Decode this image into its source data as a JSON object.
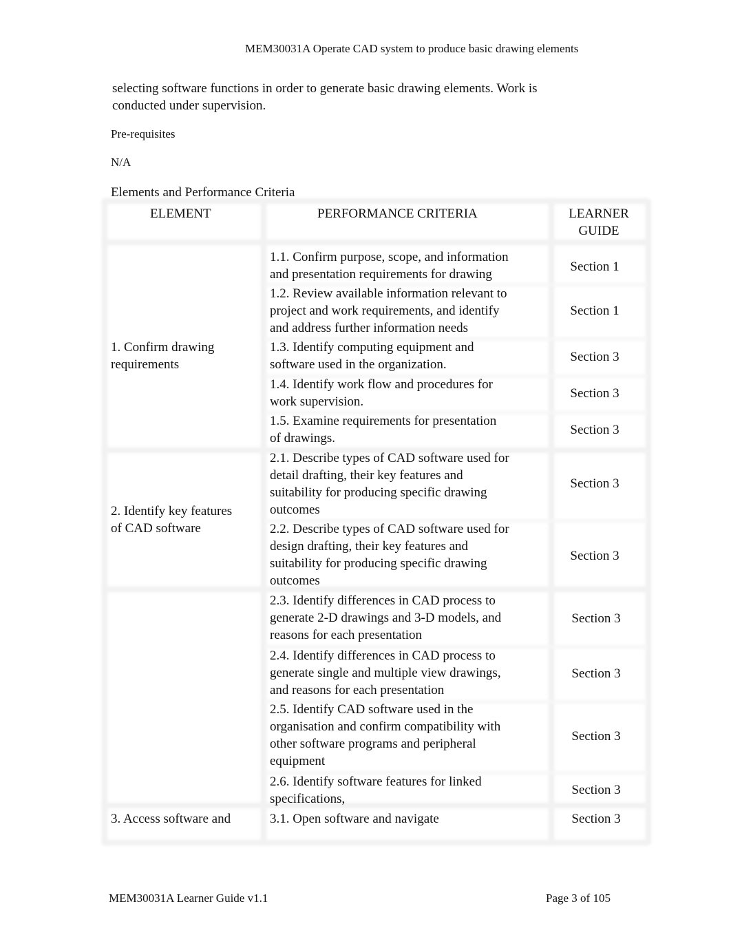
{
  "header": {
    "title": "MEM30031A  Operate CAD system to produce basic drawing elements"
  },
  "intro": "selecting software functions in order to generate basic drawing elements. Work is\nconducted under supervision.",
  "prereq_label": "Pre-requisites",
  "prereq_value": "N/A",
  "table_title": "Elements and Performance Criteria",
  "table": {
    "headers": [
      "ELEMENT",
      "PERFORMANCE CRITERIA",
      "LEARNER\nGUIDE"
    ],
    "elements": [
      "1. Confirm drawing\nrequirements",
      "2. Identify key features\nof CAD software",
      "3. Access software and"
    ],
    "rows": [
      {
        "criteria": "1.1. Confirm purpose, scope, and information\nand presentation requirements for drawing",
        "guide": "Section 1"
      },
      {
        "criteria": "1.2. Review available information relevant to\nproject and work requirements, and identify\nand address further information needs",
        "guide": "Section 1"
      },
      {
        "criteria": "1.3. Identify computing equipment and\nsoftware used in the organization.",
        "guide": "Section 3"
      },
      {
        "criteria": "1.4. Identify work flow and procedures for\nwork supervision.",
        "guide": "Section 3"
      },
      {
        "criteria": "1.5. Examine requirements for presentation\nof drawings.",
        "guide": "Section 3"
      },
      {
        "criteria": "2.1. Describe types of CAD software used for\ndetail drafting, their key features and\nsuitability for producing specific drawing\noutcomes",
        "guide": "Section 3"
      },
      {
        "criteria": "2.2. Describe types of CAD software used for\ndesign drafting, their key features and\nsuitability for producing specific drawing\noutcomes",
        "guide": "Section 3"
      },
      {
        "criteria": "2.3. Identify differences in CAD process to\ngenerate 2-D drawings and 3-D models, and\nreasons for each presentation",
        "guide": "Section 3"
      },
      {
        "criteria": "2.4. Identify differences in CAD process to\ngenerate single and multiple view drawings,\nand reasons for each presentation",
        "guide": "Section 3"
      },
      {
        "criteria": "2.5. Identify CAD software used in the\norganisation and confirm compatibility with\nother software programs and peripheral\nequipment",
        "guide": "Section 3"
      },
      {
        "criteria": "2.6. Identify software features for linked\nspecifications,",
        "guide": "Section 3"
      },
      {
        "criteria": "3.1. Open software and navigate",
        "guide": "Section 3"
      }
    ]
  },
  "footer": {
    "left": "MEM30031A Learner Guide v1.1",
    "right": "Page 3 of 105"
  }
}
